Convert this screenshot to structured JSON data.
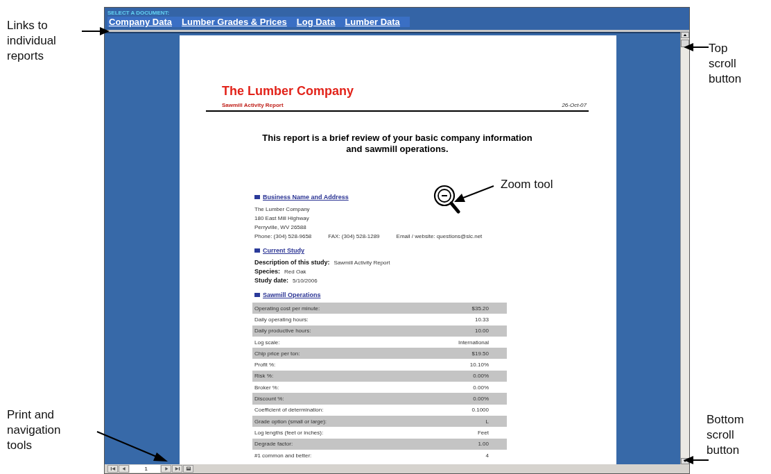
{
  "callouts_left": [
    {
      "text": "Links to individual reports"
    },
    {
      "text": "Print and navigation tools"
    }
  ],
  "callouts_right": [
    {
      "text": "Top scroll button"
    },
    {
      "text": "Bottom scroll button"
    }
  ],
  "zoom_callout": {
    "text": "Zoom tool"
  },
  "header": {
    "label": "SELECT A DOCUMENT:",
    "links": [
      "Company Data",
      "Lumber Grades & Prices",
      "Log Data",
      "Lumber Data"
    ]
  },
  "report": {
    "title": "The Lumber Company",
    "subtitle": "Sawmill Activity Report",
    "date": "26-Oct-07",
    "intro": "This report is a brief review of your basic company information and sawmill operations.",
    "business": {
      "heading": "Business Name and Address",
      "lines": [
        "The Lumber Company",
        "180 East Mill Highway",
        "Perryville, WV 26588"
      ],
      "contacts": [
        "Phone:  (304) 528-9658",
        "FAX:  (304) 528-1289",
        "Email / website:  questions@slc.net"
      ]
    },
    "study": {
      "heading": "Current Study",
      "fields": [
        {
          "label": "Description of this study:",
          "value": "Sawmill Activity Report"
        },
        {
          "label": "Species:",
          "value": "Red Oak"
        },
        {
          "label": "Study date:",
          "value": "5/10/2006"
        }
      ]
    },
    "operations": {
      "heading": "Sawmill Operations",
      "rows": [
        {
          "label": "Operating cost per minute:",
          "value": "$35.20"
        },
        {
          "label": "Daily operating hours:",
          "value": "10.33"
        },
        {
          "label": "Daily productive hours:",
          "value": "10.00"
        },
        {
          "label": "Log scale:",
          "value": "International"
        },
        {
          "label": "Chip price per ton:",
          "value": "$19.50"
        },
        {
          "label": "Profit %:",
          "value": "10.10%"
        },
        {
          "label": "Risk %:",
          "value": "0.00%"
        },
        {
          "label": "Broker %:",
          "value": "0.00%"
        },
        {
          "label": "Discount %:",
          "value": "0.00%"
        },
        {
          "label": "Coefficient of determination:",
          "value": "0.1000"
        },
        {
          "label": "Grade option (small or large):",
          "value": "L"
        },
        {
          "label": "Log lengths (feet or inches):",
          "value": "Feet"
        },
        {
          "label": "Degrade factor:",
          "value": "1.00"
        },
        {
          "label": "#1 common and better:",
          "value": "4"
        }
      ]
    }
  },
  "navigation": {
    "page": "1"
  }
}
